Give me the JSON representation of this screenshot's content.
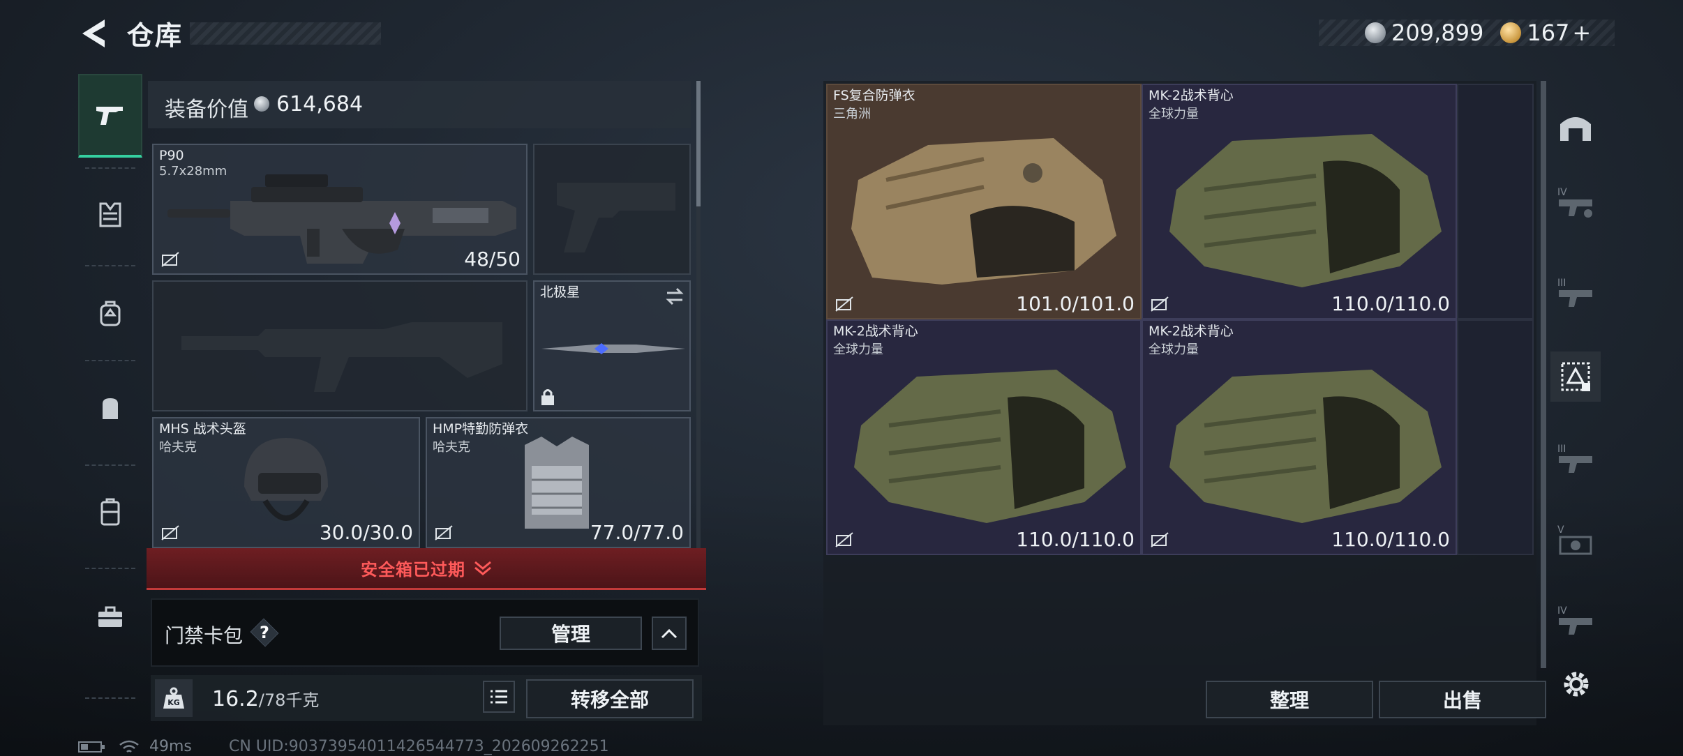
{
  "header": {
    "title": "仓库",
    "silver": "209,899",
    "gold": "167",
    "gold_plus": "+"
  },
  "equip_value": {
    "label": "装备价值",
    "value": "614,684"
  },
  "left_rail": [
    "pistol-icon",
    "vest-icon",
    "backpack-icon",
    "pouch-icon",
    "case-icon",
    "toolbox-icon"
  ],
  "slots": {
    "primary": {
      "name": "P90",
      "sub": "5.7x28mm",
      "durability": "48/50"
    },
    "melee": {
      "name": "北极星"
    },
    "helmet": {
      "name": "MHS 战术头盔",
      "sub": "哈夫克",
      "durability": "30.0/30.0"
    },
    "armor": {
      "name": "HMP特勤防弹衣",
      "sub": "哈夫克",
      "durability": "77.0/77.0"
    }
  },
  "safebox": {
    "text": "安全箱已过期"
  },
  "card_pack": {
    "label": "门禁卡包",
    "help": "?",
    "manage": "管理"
  },
  "weight": {
    "current": "16.2",
    "max": "/78千克",
    "kg": "KG"
  },
  "transfer_all": "转移全部",
  "stash": [
    {
      "name": "FS复合防弹衣",
      "sub": "三角洲",
      "durability": "101.0/101.0"
    },
    {
      "name": "MK-2战术背心",
      "sub": "全球力量",
      "durability": "110.0/110.0"
    },
    {
      "name": "MK-2战术背心",
      "sub": "全球力量",
      "durability": "110.0/110.0"
    },
    {
      "name": "MK-2战术背心",
      "sub": "全球力量",
      "durability": "110.0/110.0"
    }
  ],
  "right_rail": {
    "tiers": [
      "IV",
      "III",
      "III",
      "V",
      "IV"
    ]
  },
  "buttons": {
    "sort": "整理",
    "sell": "出售"
  },
  "status": {
    "ping": "49ms",
    "uid": "CN UID:90373954011426544773_202609262251"
  },
  "colors": {
    "accent_green": "#35d0a0",
    "alert_red": "#ff5a5a",
    "selected_slot": "#4a3a30",
    "stash_slot": "#28273f"
  }
}
